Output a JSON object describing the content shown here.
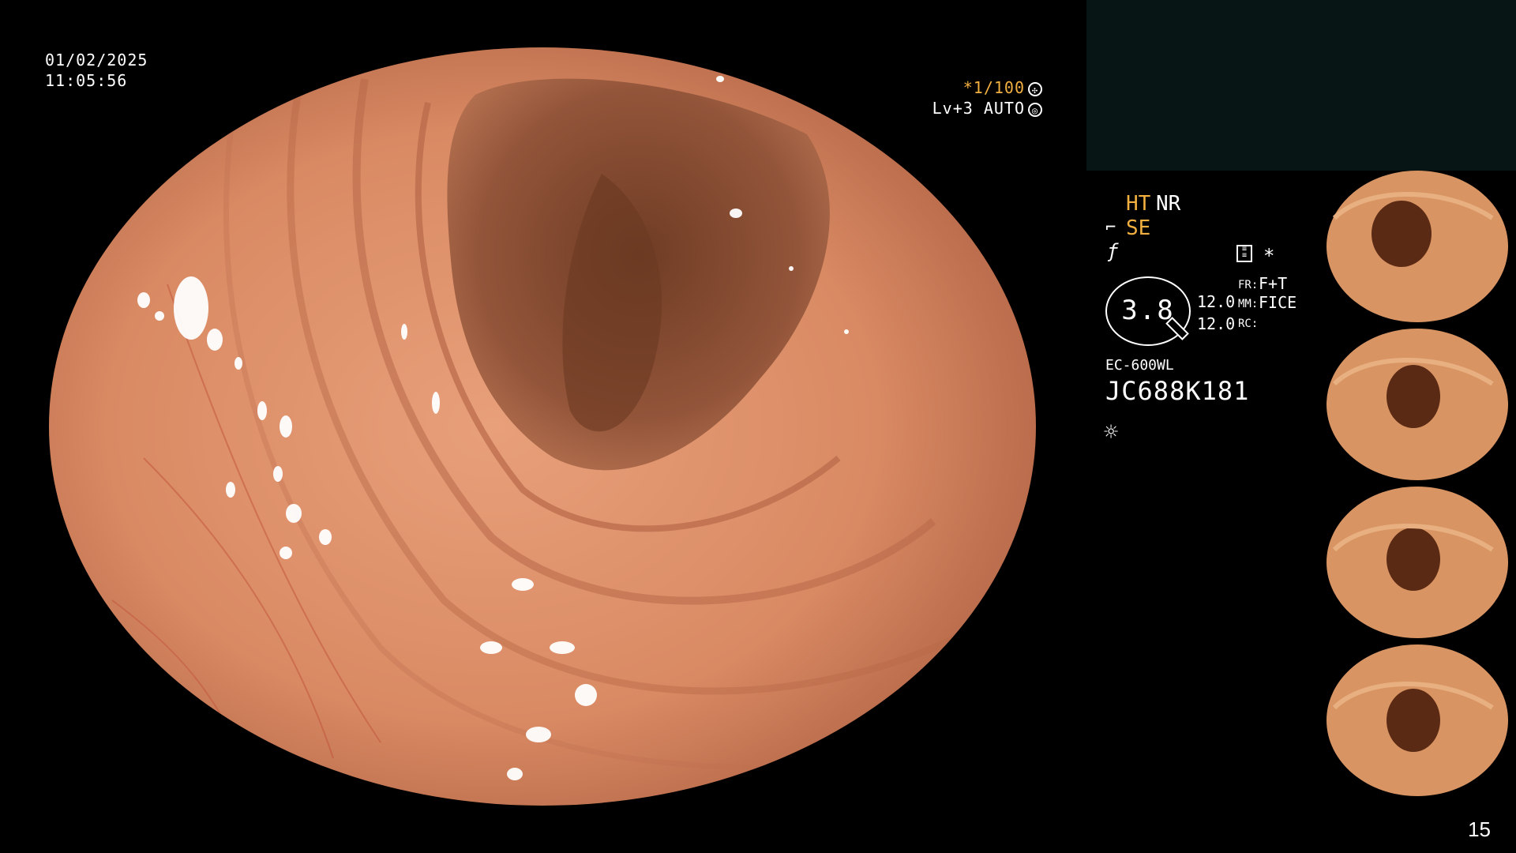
{
  "overlay": {
    "date": "01/02/2025",
    "time": "11:05:56",
    "shutter_speed": "*1/100",
    "level_mode": "Lv+3 AUTO"
  },
  "status": {
    "mode_ht": "HT",
    "mode_nr": "NR",
    "mode_se": "SE",
    "zoom_value": "3.8",
    "value_1": "12.0",
    "value_2": "12.0",
    "fr_label": "FR:",
    "fr_value": "F+T",
    "mm_label": "MM:",
    "mm_value": "FICE",
    "rc_label": "RC:",
    "scope_model": "EC-600WL",
    "serial": "JC688K181"
  },
  "icons": [
    "aperture-icon",
    "focus-icon",
    "scope-icon",
    "f-icon",
    "doc-icon",
    "star-icon",
    "sun-icon"
  ],
  "colors": {
    "accent": "#f2b040",
    "panel": "#071614",
    "background": "#000000"
  },
  "page_number": "15"
}
